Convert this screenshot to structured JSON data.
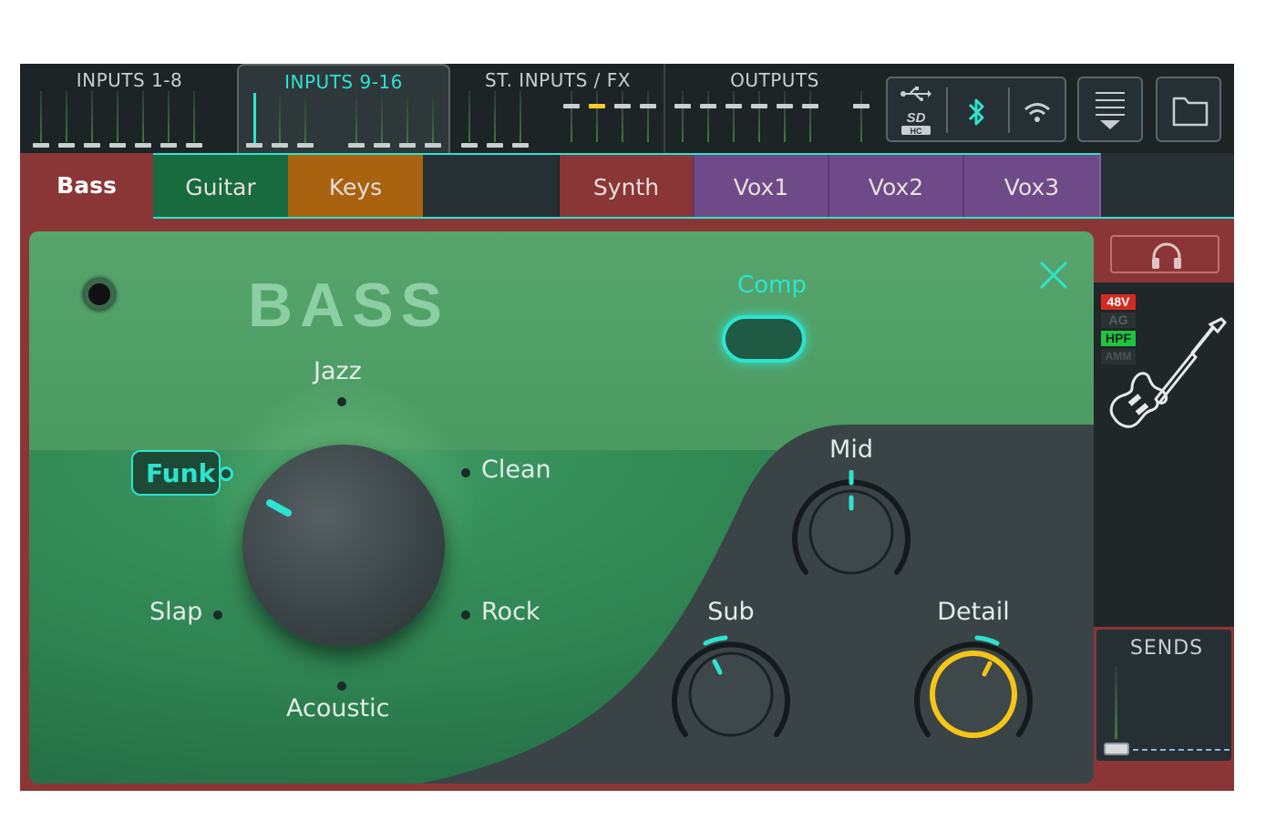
{
  "banks": [
    {
      "label": "INPUTS 1-8",
      "active": false
    },
    {
      "label": "INPUTS 9-16",
      "active": true
    },
    {
      "label": "ST. INPUTS / FX",
      "active": false
    },
    {
      "label": "OUTPUTS",
      "active": false
    }
  ],
  "io_icons": [
    "usb-icon",
    "sd-hc-icon",
    "bluetooth-icon",
    "wifi-icon"
  ],
  "toolbar_icons": [
    "menu-icon",
    "folder-icon"
  ],
  "tabs": [
    {
      "label": "Bass",
      "color": "#8b3636",
      "active": true
    },
    {
      "label": "Guitar",
      "color": "#176b3e"
    },
    {
      "label": "Keys",
      "color": "#a9620f"
    },
    {
      "label": "",
      "color": "#263034"
    },
    {
      "label": "Synth",
      "color": "#8b3636"
    },
    {
      "label": "Vox1",
      "color": "#6e4a88"
    },
    {
      "label": "Vox2",
      "color": "#6e4a88"
    },
    {
      "label": "Vox3",
      "color": "#6e4a88"
    }
  ],
  "panel": {
    "title": "BASS",
    "comp_label": "Comp",
    "styles": {
      "jazz": "Jazz",
      "funk": "Funk",
      "clean": "Clean",
      "slap": "Slap",
      "rock": "Rock",
      "acoustic": "Acoustic",
      "selected": "Funk"
    },
    "knobs": {
      "mid": "Mid",
      "sub": "Sub",
      "detail": "Detail"
    }
  },
  "flags": {
    "phantom": "48V",
    "ag": "AG",
    "hpf": "HPF",
    "amm": "AMM"
  },
  "sends_label": "SENDS",
  "colors": {
    "accent": "#2ee3cf",
    "detail_ring": "#f5c518",
    "channel_red": "#8b3636",
    "panel_green": "#2f8452"
  }
}
